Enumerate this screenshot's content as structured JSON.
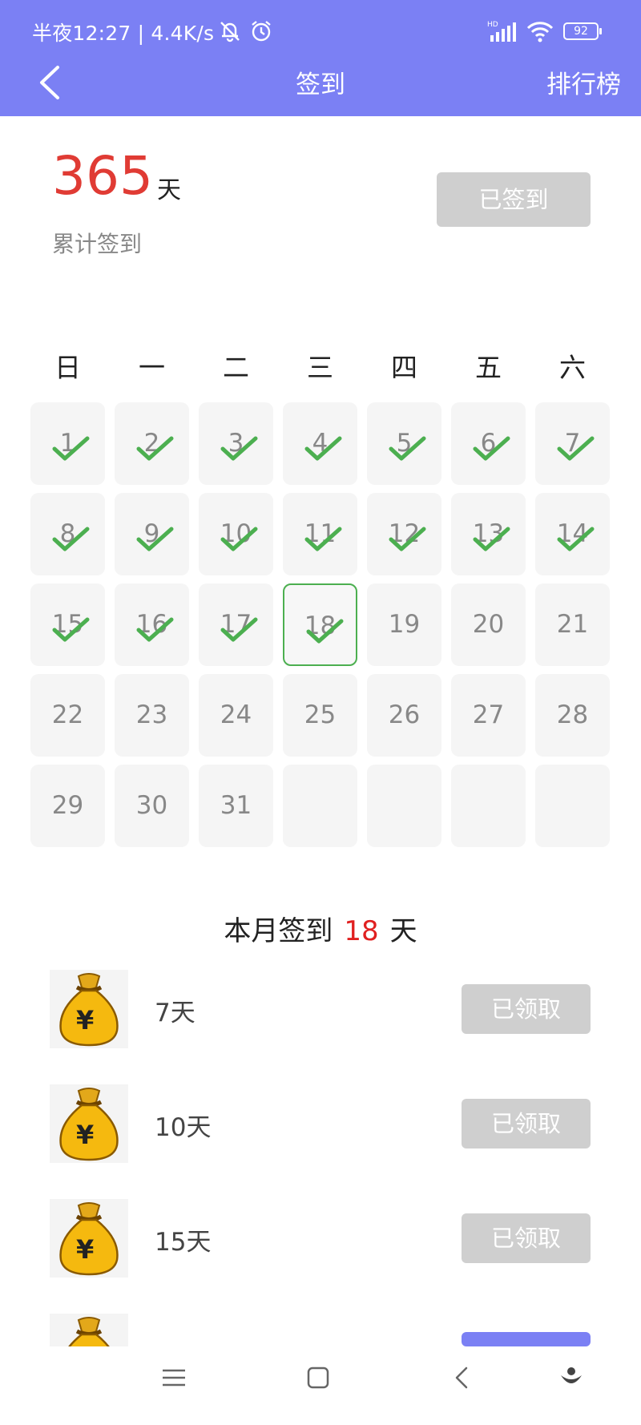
{
  "status_bar": {
    "time_text": "半夜12:27 | 4.4K/s",
    "battery": "92",
    "icons": [
      "mute-bell-icon",
      "alarm-icon",
      "signal-icon",
      "wifi-icon",
      "battery-icon"
    ]
  },
  "header": {
    "title": "签到",
    "right_button": "排行榜",
    "background": "#7b80f4"
  },
  "summary": {
    "total_days": "365",
    "unit": "天",
    "caption": "累计签到",
    "sign_button": "已签到"
  },
  "calendar": {
    "weekdays": [
      "日",
      "一",
      "二",
      "三",
      "四",
      "五",
      "六"
    ],
    "days": [
      "1",
      "2",
      "3",
      "4",
      "5",
      "6",
      "7",
      "8",
      "9",
      "10",
      "11",
      "12",
      "13",
      "14",
      "15",
      "16",
      "17",
      "18",
      "19",
      "20",
      "21",
      "22",
      "23",
      "24",
      "25",
      "26",
      "27",
      "28",
      "29",
      "30",
      "31"
    ],
    "checked_through": 18,
    "today": 18,
    "check_color": "#4caf50"
  },
  "month_summary": {
    "prefix": "本月签到",
    "count": "18",
    "suffix": "天"
  },
  "rewards": [
    {
      "label": "7天",
      "button": "已领取"
    },
    {
      "label": "10天",
      "button": "已领取"
    },
    {
      "label": "15天",
      "button": "已领取"
    }
  ]
}
